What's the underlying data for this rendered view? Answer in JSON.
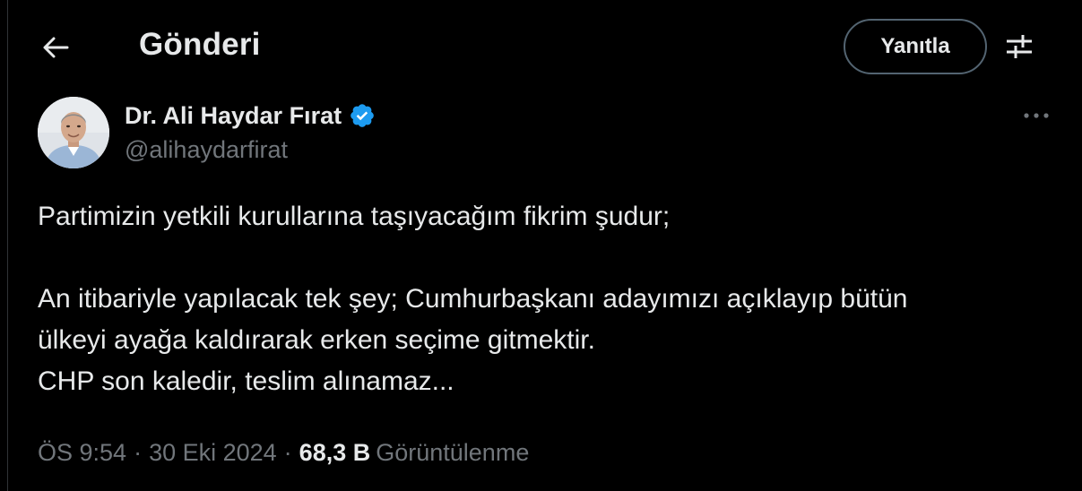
{
  "header": {
    "title": "Gönderi",
    "reply_label": "Yanıtla",
    "back_icon": "arrow-left-icon",
    "settings_icon": "sliders-icon"
  },
  "author": {
    "name": "Dr. Ali Haydar Fırat",
    "handle": "@alihaydarfirat",
    "verified": true,
    "verified_color": "#1d9bf0"
  },
  "tweet": {
    "line1": "Partimizin yetkili kurullarına taşıyacağım fikrim şudur;",
    "line2": "An itibariyle yapılacak tek şey; Cumhurbaşkanı adayımızı açıklayıp bütün",
    "line3": "ülkeyi ayağa kaldırarak erken seçime gitmektir.",
    "line4": "CHP son kaledir, teslim alınamaz..."
  },
  "meta": {
    "time": "ÖS 9:54",
    "separator": "·",
    "date": "30 Eki 2024",
    "views_count": "68,3 B",
    "views_label": "Görüntülenme"
  },
  "colors": {
    "background": "#000000",
    "text_primary": "#e7e9ea",
    "text_secondary": "#71767b",
    "border": "#2f3336",
    "accent": "#1d9bf0"
  }
}
